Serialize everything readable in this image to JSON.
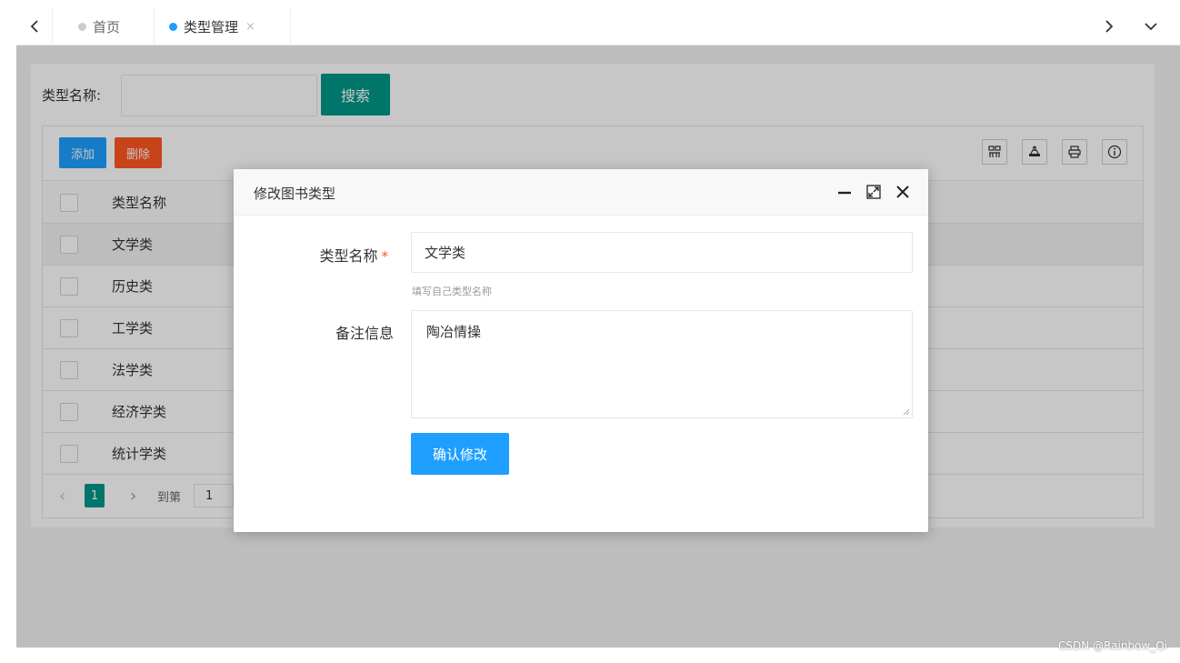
{
  "tabs": {
    "home_label": "首页",
    "active_label": "类型管理",
    "close_glyph": "×"
  },
  "search": {
    "label": "类型名称:",
    "button_label": "搜索",
    "input_value": ""
  },
  "toolbar": {
    "add_label": "添加",
    "delete_label": "删除",
    "icons": [
      "columns-icon",
      "export-icon",
      "print-icon",
      "info-icon"
    ]
  },
  "table": {
    "header": "类型名称",
    "rows": [
      "文学类",
      "历史类",
      "工学类",
      "法学类",
      "经济学类",
      "统计学类"
    ]
  },
  "pager": {
    "current_page": "1",
    "goto_label": "到第",
    "goto_value": "1"
  },
  "dialog": {
    "title": "修改图书类型",
    "name_label": "类型名称",
    "required_mark": "*",
    "name_value": "文学类",
    "name_hint": "填写自己类型名称",
    "remark_label": "备注信息",
    "remark_value": "陶冶情操",
    "submit_label": "确认修改"
  },
  "colors": {
    "teal": "#009688",
    "blue": "#1e9fff",
    "orange": "#ff5722"
  },
  "watermark": "CSDN @Rainbow_Qi"
}
